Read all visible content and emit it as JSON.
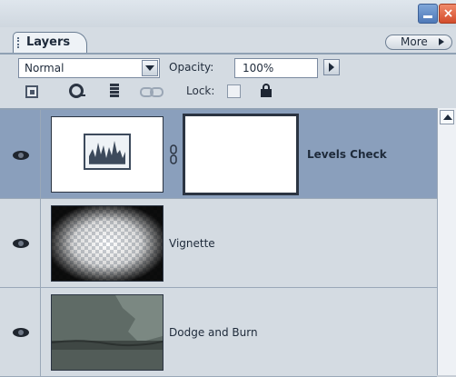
{
  "panel": {
    "tab_label": "Layers",
    "more_label": "More",
    "close_glyph": "×"
  },
  "controls": {
    "blend_mode": "Normal",
    "opacity_label": "Opacity:",
    "opacity_value": "100%",
    "lock_label": "Lock:"
  },
  "icons": [
    "lock-transparent-icon",
    "brush-icon",
    "move-icon",
    "link-icon",
    "lock-checkbox-icon",
    "padlock-icon",
    "eye-icon",
    "histogram-icon",
    "chain-icon"
  ],
  "layers": [
    {
      "name": "Levels Check",
      "selected": true
    },
    {
      "name": "Vignette",
      "selected": false
    },
    {
      "name": "Dodge and Burn",
      "selected": false
    }
  ],
  "colors": {
    "panel_bg": "#d4dbe2",
    "selected_row": "#8a9fbc",
    "close_button": "#d34c2b",
    "minimize_button": "#4f79b8"
  }
}
